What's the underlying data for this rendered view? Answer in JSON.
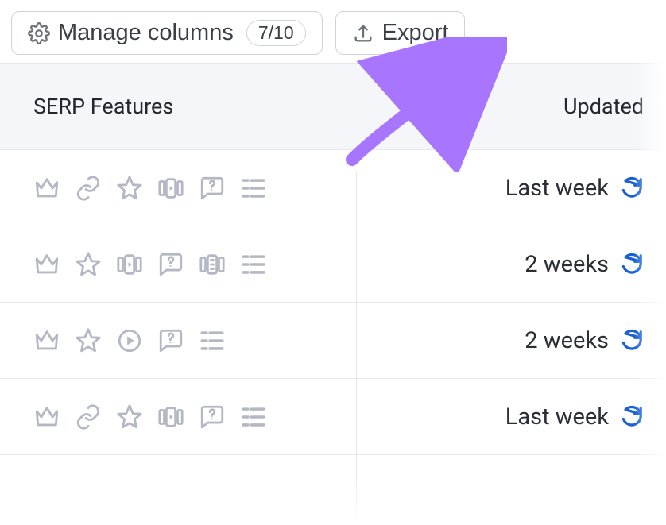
{
  "toolbar": {
    "manage_columns_label": "Manage columns",
    "column_ratio": "7/10",
    "export_label": "Export"
  },
  "table": {
    "header_features": "SERP Features",
    "header_updated": "Updated"
  },
  "feature_icons": {
    "crown": "crown-icon",
    "link": "link-icon",
    "star": "star-icon",
    "video_carousel": "video-carousel-icon",
    "faq": "faq-icon",
    "list": "list-icon",
    "knowledge_panel": "knowledge-panel-icon",
    "video": "video-icon"
  },
  "rows": [
    {
      "features": [
        "crown",
        "link",
        "star",
        "video_carousel",
        "faq",
        "list"
      ],
      "updated": "Last week"
    },
    {
      "features": [
        "crown",
        "star",
        "video_carousel",
        "faq",
        "knowledge_panel",
        "list"
      ],
      "updated": "2 weeks"
    },
    {
      "features": [
        "crown",
        "star",
        "video",
        "faq",
        "list"
      ],
      "updated": "2 weeks"
    },
    {
      "features": [
        "crown",
        "link",
        "star",
        "video_carousel",
        "faq",
        "list"
      ],
      "updated": "Last week"
    }
  ],
  "colors": {
    "icon_grey": "#b3b8c4",
    "refresh_blue": "#1860d3",
    "arrow_purple": "#a875ff"
  }
}
